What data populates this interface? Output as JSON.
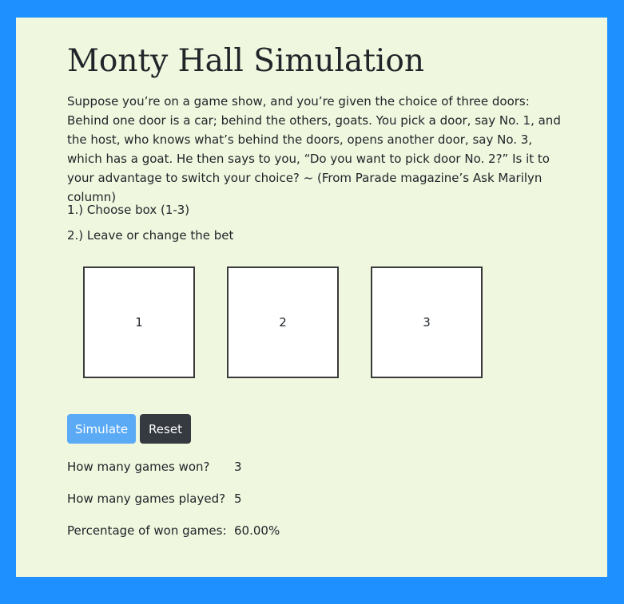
{
  "page": {
    "title": "Monty Hall Simulation",
    "intro": "Suppose you’re on a game show, and you’re given the choice of three doors: Behind one door is a car; behind the others, goats. You pick a door, say No. 1, and the host, who knows what’s behind the doors, opens another door, say No. 3, which has a goat. He then says to you, “Do you want to pick door No. 2?” Is it to your advantage to switch your choice? ~ (From Parade magazine’s Ask Marilyn column)",
    "steps": [
      "1.) Choose box (1-3)",
      "2.) Leave or change the bet"
    ]
  },
  "boxes": [
    {
      "label": "1"
    },
    {
      "label": "2"
    },
    {
      "label": "3"
    }
  ],
  "buttons": {
    "simulate_label": "Simulate",
    "reset_label": "Reset"
  },
  "stats": [
    {
      "label": "How many games won?",
      "value": "3"
    },
    {
      "label": "How many games played?",
      "value": "5"
    },
    {
      "label": "Percentage of won games:",
      "value": "60.00%"
    }
  ],
  "colors": {
    "page_background": "#1e90ff",
    "panel_background": "#f0f7df",
    "simulate_button": "#5aaaf6",
    "reset_button": "#343a40"
  }
}
